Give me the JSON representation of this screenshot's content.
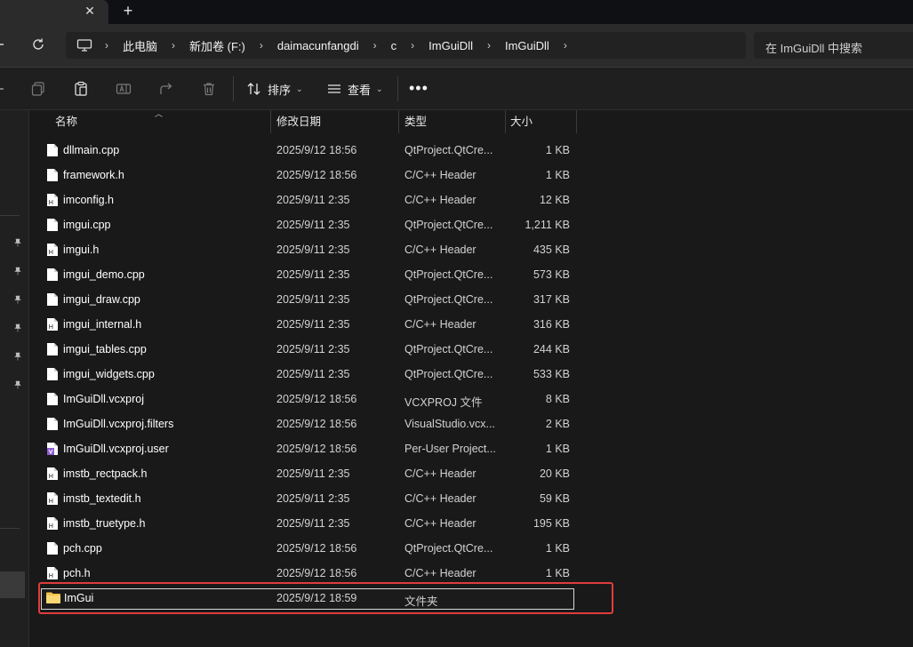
{
  "tabs": {
    "close_glyph": "✕",
    "new_glyph": "+"
  },
  "breadcrumb": [
    "此电脑",
    "新加卷 (F:)",
    "daimacunfangdi",
    "c",
    "ImGuiDll",
    "ImGuiDll"
  ],
  "breadcrumb_sep": "›",
  "search": {
    "placeholder": "在 ImGuiDll 中搜索"
  },
  "toolbar": {
    "sort_label": "排序",
    "view_label": "查看",
    "more": "•••",
    "chevron": "⌄"
  },
  "columns": {
    "name": "名称",
    "date": "修改日期",
    "type": "类型",
    "size": "大小",
    "sort_caret": "︿"
  },
  "files": [
    {
      "name": "dllmain.cpp",
      "date": "2025/9/12 18:56",
      "type": "QtProject.QtCre...",
      "size": "1 KB",
      "icon": "file"
    },
    {
      "name": "framework.h",
      "date": "2025/9/12 18:56",
      "type": "C/C++ Header",
      "size": "1 KB",
      "icon": "file"
    },
    {
      "name": "imconfig.h",
      "date": "2025/9/11 2:35",
      "type": "C/C++ Header",
      "size": "12 KB",
      "icon": "file-h"
    },
    {
      "name": "imgui.cpp",
      "date": "2025/9/11 2:35",
      "type": "QtProject.QtCre...",
      "size": "1,211 KB",
      "icon": "file"
    },
    {
      "name": "imgui.h",
      "date": "2025/9/11 2:35",
      "type": "C/C++ Header",
      "size": "435 KB",
      "icon": "file-h"
    },
    {
      "name": "imgui_demo.cpp",
      "date": "2025/9/11 2:35",
      "type": "QtProject.QtCre...",
      "size": "573 KB",
      "icon": "file"
    },
    {
      "name": "imgui_draw.cpp",
      "date": "2025/9/11 2:35",
      "type": "QtProject.QtCre...",
      "size": "317 KB",
      "icon": "file"
    },
    {
      "name": "imgui_internal.h",
      "date": "2025/9/11 2:35",
      "type": "C/C++ Header",
      "size": "316 KB",
      "icon": "file-h"
    },
    {
      "name": "imgui_tables.cpp",
      "date": "2025/9/11 2:35",
      "type": "QtProject.QtCre...",
      "size": "244 KB",
      "icon": "file"
    },
    {
      "name": "imgui_widgets.cpp",
      "date": "2025/9/11 2:35",
      "type": "QtProject.QtCre...",
      "size": "533 KB",
      "icon": "file"
    },
    {
      "name": "ImGuiDll.vcxproj",
      "date": "2025/9/12 18:56",
      "type": "VCXPROJ 文件",
      "size": "8 KB",
      "icon": "file"
    },
    {
      "name": "ImGuiDll.vcxproj.filters",
      "date": "2025/9/12 18:56",
      "type": "VisualStudio.vcx...",
      "size": "2 KB",
      "icon": "file"
    },
    {
      "name": "ImGuiDll.vcxproj.user",
      "date": "2025/9/12 18:56",
      "type": "Per-User Project...",
      "size": "1 KB",
      "icon": "file-vs"
    },
    {
      "name": "imstb_rectpack.h",
      "date": "2025/9/11 2:35",
      "type": "C/C++ Header",
      "size": "20 KB",
      "icon": "file-h"
    },
    {
      "name": "imstb_textedit.h",
      "date": "2025/9/11 2:35",
      "type": "C/C++ Header",
      "size": "59 KB",
      "icon": "file-h"
    },
    {
      "name": "imstb_truetype.h",
      "date": "2025/9/11 2:35",
      "type": "C/C++ Header",
      "size": "195 KB",
      "icon": "file-h"
    },
    {
      "name": "pch.cpp",
      "date": "2025/9/12 18:56",
      "type": "QtProject.QtCre...",
      "size": "1 KB",
      "icon": "file"
    },
    {
      "name": "pch.h",
      "date": "2025/9/12 18:56",
      "type": "C/C++ Header",
      "size": "1 KB",
      "icon": "file-h"
    }
  ],
  "new_folder": {
    "name": "ImGui",
    "date": "2025/9/12 18:59",
    "type": "文件夹",
    "size": "",
    "icon": "folder"
  },
  "colors": {
    "highlight": "#e03c3c",
    "folder": "#f2c14e",
    "background": "#191919"
  }
}
